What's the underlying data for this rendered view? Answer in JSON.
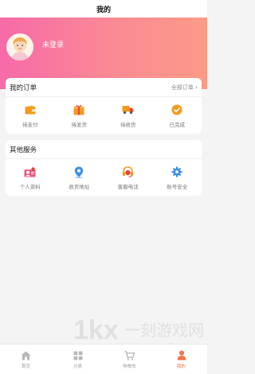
{
  "header": {
    "title": "我的"
  },
  "profile": {
    "login_status": "未登录"
  },
  "orders": {
    "title": "我的订单",
    "all_orders_label": "全部订单",
    "items": [
      {
        "label": "待支付",
        "icon": "wallet-icon"
      },
      {
        "label": "待发货",
        "icon": "package-icon"
      },
      {
        "label": "待收货",
        "icon": "truck-icon"
      },
      {
        "label": "已完成",
        "icon": "check-circle-icon"
      }
    ]
  },
  "services": {
    "title": "其他服务",
    "items": [
      {
        "label": "个人资料",
        "icon": "user-card-icon"
      },
      {
        "label": "收货地址",
        "icon": "location-pin-icon"
      },
      {
        "label": "客服电话",
        "icon": "headset-icon"
      },
      {
        "label": "账号安全",
        "icon": "gear-icon"
      }
    ]
  },
  "watermark": {
    "text": "1kx 一刻游戏网",
    "url": "www.1kyx.com"
  },
  "tab_bar": {
    "active_index": 3,
    "tabs": [
      {
        "label": "首页",
        "icon": "home-icon"
      },
      {
        "label": "分类",
        "icon": "category-grid-icon"
      },
      {
        "label": "购物车",
        "icon": "cart-icon"
      },
      {
        "label": "我的",
        "icon": "profile-icon"
      }
    ]
  },
  "colors": {
    "accent": "#f0744a",
    "hero_gradient_start": "#f76aa8",
    "hero_gradient_end": "#fc9a86",
    "icon_orange": "#f39a1e",
    "icon_red": "#e8463e",
    "icon_blue": "#3a8ee8",
    "icon_pink": "#e75a82"
  }
}
